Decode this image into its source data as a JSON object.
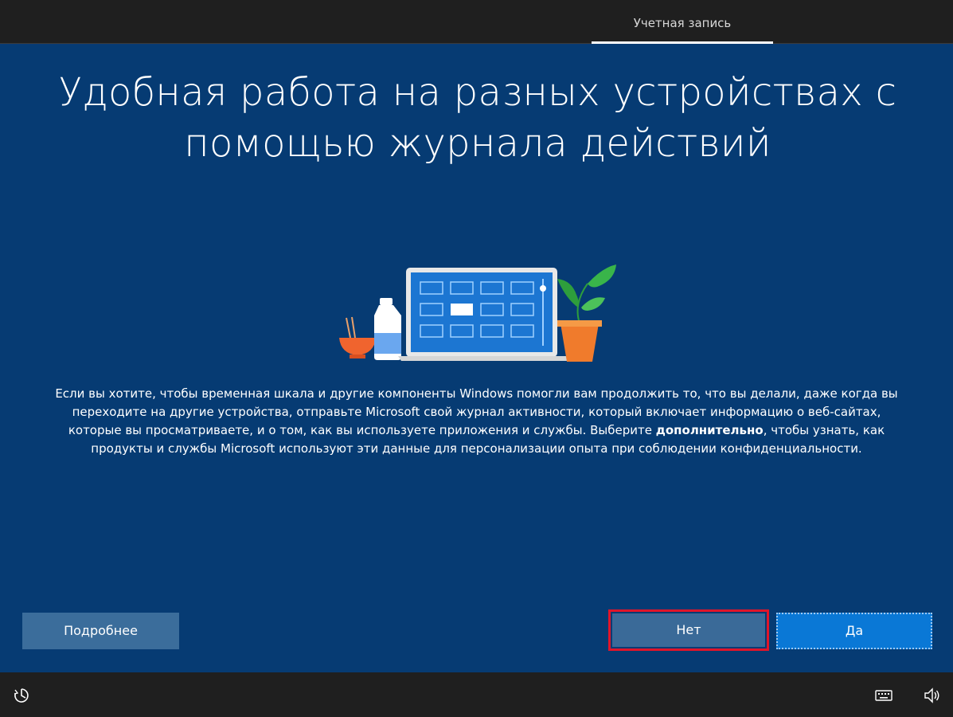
{
  "header": {
    "tab_label": "Учетная запись"
  },
  "main": {
    "title_line1": "Удобная работа на разных устройствах с",
    "title_line2": "помощью журнала действий",
    "description": {
      "part1": "Если вы хотите, чтобы временная шкала и другие компоненты Windows помогли вам продолжить то, что вы делали, даже когда вы переходите на другие устройства, отправьте Microsoft свой журнал активности, который включает информацию о веб-сайтах, которые вы просматриваете, и о том, как вы используете приложения и службы. Выберите ",
      "bold": "дополнительно",
      "part2": ", чтобы узнать, как продукты и службы Microsoft используют эти данные для персонализации опыта при соблюдении конфиденциальности."
    }
  },
  "buttons": {
    "more": "Подробнее",
    "no": "Нет",
    "yes": "Да"
  },
  "icons": {
    "accessibility": "ease-of-access-icon",
    "keyboard": "keyboard-icon",
    "volume": "volume-icon"
  },
  "colors": {
    "background": "#063b73",
    "bar": "#1f1f1f",
    "primary_button": "#0a78d6",
    "highlight": "#e0152a"
  }
}
